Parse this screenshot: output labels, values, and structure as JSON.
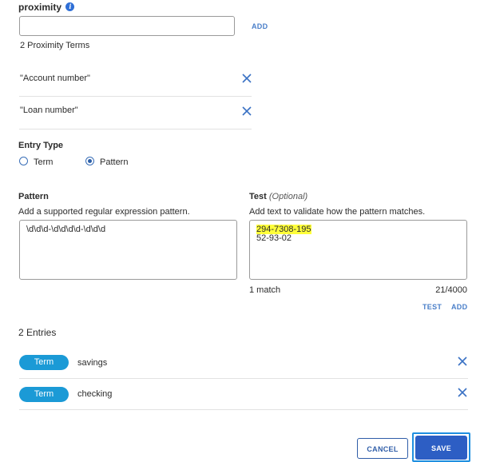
{
  "proximity": {
    "label": "proximity",
    "input_value": "",
    "add_label": "ADD",
    "count_label": "2 Proximity Terms",
    "terms": [
      {
        "text": "\"Account number\""
      },
      {
        "text": "\"Loan number\""
      }
    ]
  },
  "entry_type": {
    "label": "Entry Type",
    "options": [
      {
        "label": "Term",
        "checked": false
      },
      {
        "label": "Pattern",
        "checked": true
      }
    ]
  },
  "pattern": {
    "label": "Pattern",
    "help": "Add a supported regular expression pattern.",
    "value": "\\d\\d\\d-\\d\\d\\d\\d-\\d\\d\\d"
  },
  "test": {
    "label": "Test",
    "optional": "(Optional)",
    "help": "Add text to validate how the pattern matches.",
    "line1": "294-7308-195",
    "line2": "52-93-02",
    "match_count": "1 match",
    "char_count": "21/4000",
    "test_label": "TEST",
    "add_label": "ADD"
  },
  "entries": {
    "count_label": "2 Entries",
    "items": [
      {
        "type": "Term",
        "value": "savings"
      },
      {
        "type": "Term",
        "value": "checking"
      }
    ]
  },
  "footer": {
    "cancel_label": "CANCEL",
    "save_label": "SAVE"
  },
  "colors": {
    "accent": "#2d5ec4",
    "pill": "#1b9ad6",
    "highlight": "#ffff3a",
    "link": "#4a7fc9"
  }
}
